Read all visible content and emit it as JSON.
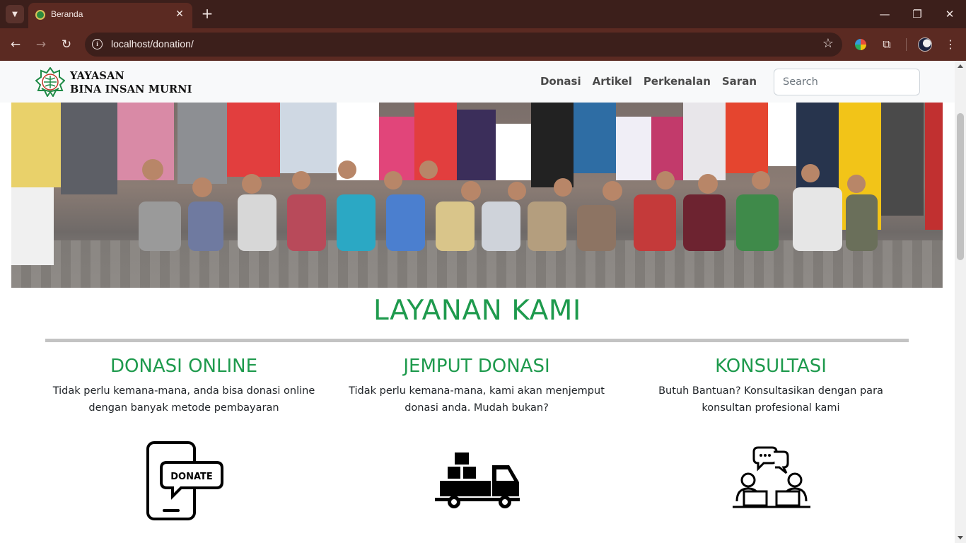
{
  "browser": {
    "tab": {
      "title": "Beranda"
    },
    "address": {
      "url": "localhost/donation/"
    }
  },
  "site": {
    "logo": {
      "line1": "YAYASAN",
      "line2": "BINA INSAN MURNI"
    },
    "nav": [
      {
        "label": "Donasi"
      },
      {
        "label": "Artikel"
      },
      {
        "label": "Perkenalan"
      },
      {
        "label": "Saran"
      }
    ],
    "search": {
      "placeholder": "Search"
    }
  },
  "services": {
    "title": "LAYANAN KAMI",
    "items": [
      {
        "title": "DONASI ONLINE",
        "desc": "Tidak perlu kemana-mana, anda bisa donasi online dengan banyak metode pembayaran",
        "icon": "phone-donate-icon",
        "icon_text": "DONATE"
      },
      {
        "title": "JEMPUT DONASI",
        "desc": "Tidak perlu kemana-mana, kami akan menjemput donasi anda. Mudah bukan?",
        "icon": "delivery-truck-icon"
      },
      {
        "title": "KONSULTASI",
        "desc": "Butuh Bantuan? Konsultasikan dengan para konsultan profesional kami",
        "icon": "consultation-icon"
      }
    ]
  },
  "colors": {
    "brand_green": "#1e9a4d",
    "chrome_dark": "#3c1f1b",
    "chrome_toolbar": "#5b2a22"
  }
}
